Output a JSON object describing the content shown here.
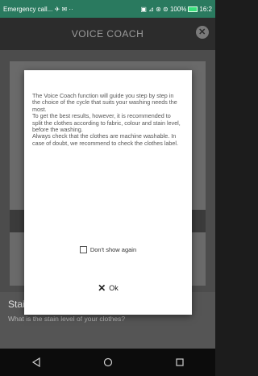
{
  "status_bar": {
    "left_text": "Emergency call... ✈ ✉ ··",
    "right_text": "▣ ⊿ ⊛ ⊜ 100%",
    "time": "16:2"
  },
  "header": {
    "title": "VOICE COACH",
    "close_symbol": "✕"
  },
  "dialog": {
    "paragraphs": [
      "The Voice Coach function will guide you step by step in the choice of the cycle that suits your washing needs the most.",
      "To get the best results, however, it is recommended to split the clothes according to fabric, colour and stain level, before the washing.",
      "Always check that the clothes are machine washable. In case of doubt, we recommend to check the clothes label."
    ],
    "checkbox_label": "Don't show again",
    "ok_label": "Ok"
  },
  "background_section": {
    "title": "Stain level",
    "subtitle": "What is the stain level of your clothes?"
  },
  "nav": {
    "back": "back-icon",
    "home": "home-icon",
    "recents": "recents-icon"
  },
  "colors": {
    "status_bar": "#2a7a5f",
    "header": "#2c2c2c",
    "dialog": "#ffffff",
    "nav_bar": "#0c0c0c"
  }
}
